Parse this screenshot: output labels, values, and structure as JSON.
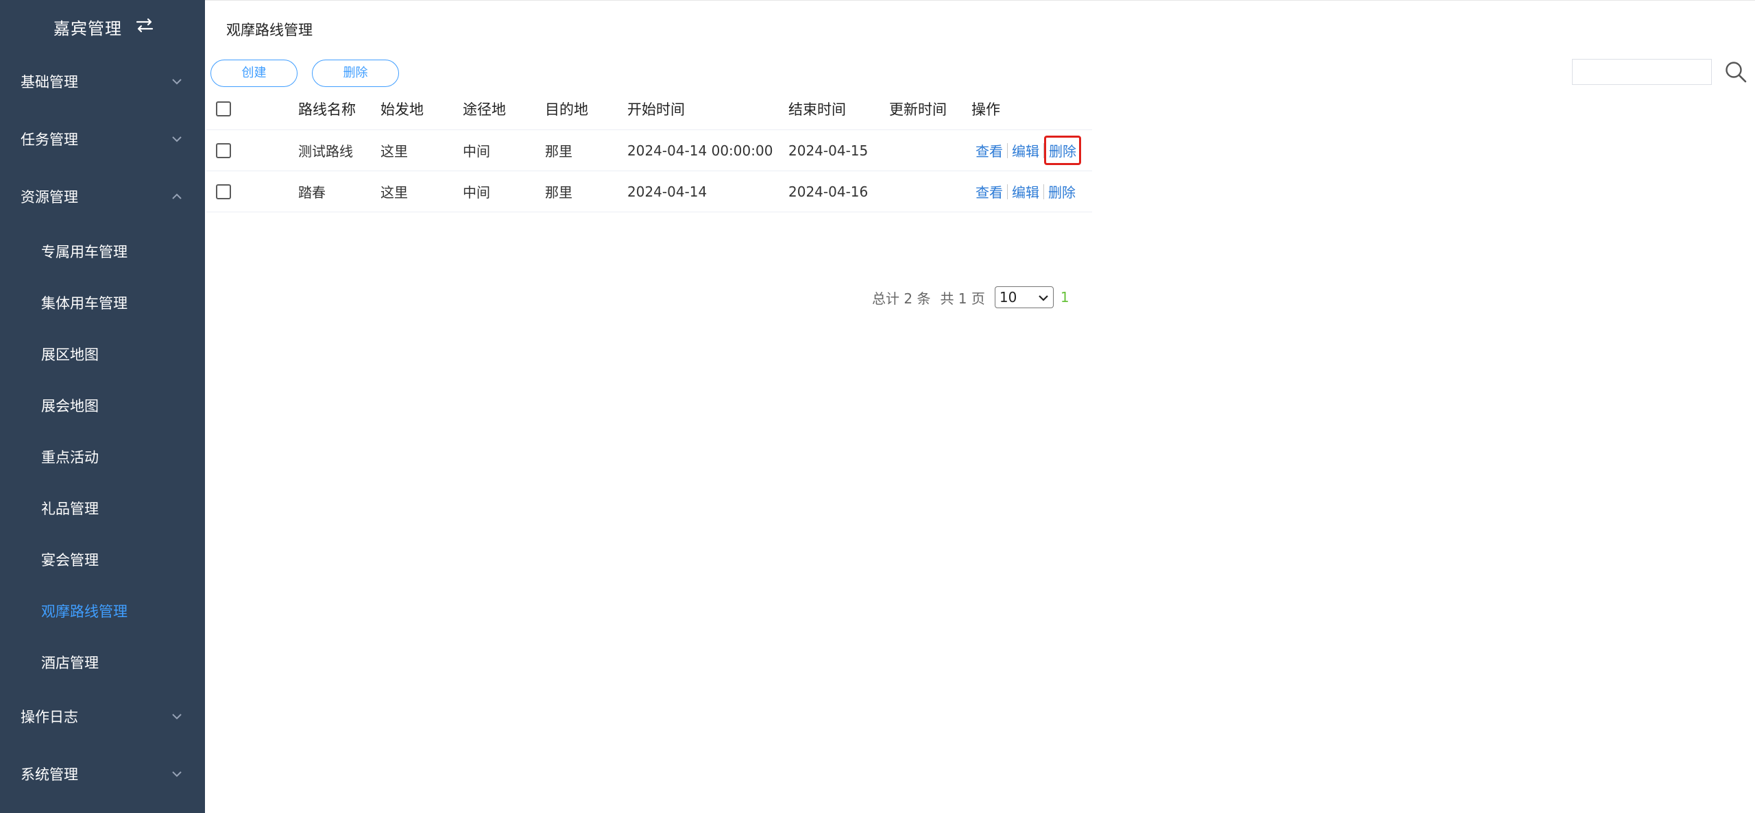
{
  "sidebar": {
    "brand": "嘉宾管理",
    "groups": [
      {
        "label": "基础管理",
        "expanded": false
      },
      {
        "label": "任务管理",
        "expanded": false
      },
      {
        "label": "资源管理",
        "expanded": true
      },
      {
        "label": "操作日志",
        "expanded": false
      },
      {
        "label": "系统管理",
        "expanded": false
      }
    ],
    "resource_items": [
      {
        "label": "专属用车管理"
      },
      {
        "label": "集体用车管理"
      },
      {
        "label": "展区地图"
      },
      {
        "label": "展会地图"
      },
      {
        "label": "重点活动"
      },
      {
        "label": "礼品管理"
      },
      {
        "label": "宴会管理"
      },
      {
        "label": "观摩路线管理",
        "active": true
      },
      {
        "label": "酒店管理"
      }
    ],
    "active_color": "#409eff",
    "background": "#304156"
  },
  "page": {
    "title": "观摩路线管理"
  },
  "toolbar": {
    "create_label": "创建",
    "delete_label": "删除",
    "search_value": ""
  },
  "table": {
    "columns": [
      "路线名称",
      "始发地",
      "途径地",
      "目的地",
      "开始时间",
      "结束时间",
      "更新时间",
      "操作"
    ],
    "rows": [
      {
        "name": "测试路线",
        "origin": "这里",
        "via": "中间",
        "dest": "那里",
        "start": "2024-04-14 00:00:00",
        "end": "2024-04-15",
        "updated": "",
        "view": "查看",
        "edit": "编辑",
        "delete": "删除"
      },
      {
        "name": "踏春",
        "origin": "这里",
        "via": "中间",
        "dest": "那里",
        "start": "2024-04-14",
        "end": "2024-04-16",
        "updated": "",
        "view": "查看",
        "edit": "编辑",
        "delete": "删除"
      }
    ]
  },
  "pagination": {
    "total_text": "总计 2 条",
    "pages_text": "共 1 页",
    "page_size": "10",
    "current_page": "1"
  }
}
